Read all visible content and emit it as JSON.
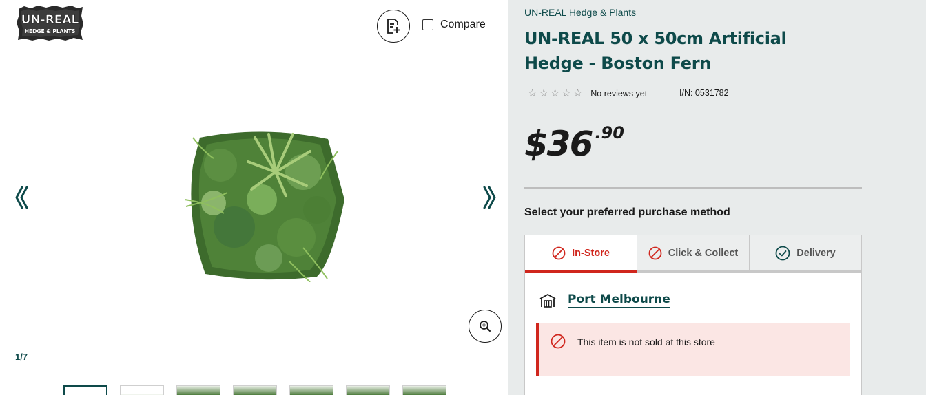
{
  "gallery": {
    "logo": {
      "line1": "UN-REAL",
      "line2": "HEDGE & PLANTS"
    },
    "compare_label": "Compare",
    "counter": "1/7",
    "product_image": "artificial-hedge-boston-fern-image",
    "thumbnail_count": 7
  },
  "product": {
    "brand_link": "UN-REAL Hedge & Plants",
    "title": "UN-REAL 50 x 50cm Artificial Hedge - Boston Fern",
    "rating": {
      "stars": 0,
      "max_stars": 5,
      "reviews_text": "No reviews yet"
    },
    "item_number": "I/N: 0531782",
    "price": {
      "dollars": "$36",
      "cents": ".90"
    }
  },
  "purchase": {
    "heading": "Select your preferred purchase method",
    "tabs": [
      {
        "label": "In-Store",
        "icon": "prohibited-icon",
        "active": true
      },
      {
        "label": "Click & Collect",
        "icon": "prohibited-icon",
        "active": false
      },
      {
        "label": "Delivery",
        "icon": "check-circle-icon",
        "active": false
      }
    ],
    "store": {
      "name": "Port Melbourne",
      "icon": "store-icon"
    },
    "alert": {
      "text": "This item is not sold at this store",
      "icon": "prohibited-icon"
    }
  },
  "colors": {
    "brand_teal": "#0e4a4a",
    "alert_red": "#d0261d",
    "panel_bg": "#e8ebeb",
    "alert_bg": "#fbe6e4"
  }
}
